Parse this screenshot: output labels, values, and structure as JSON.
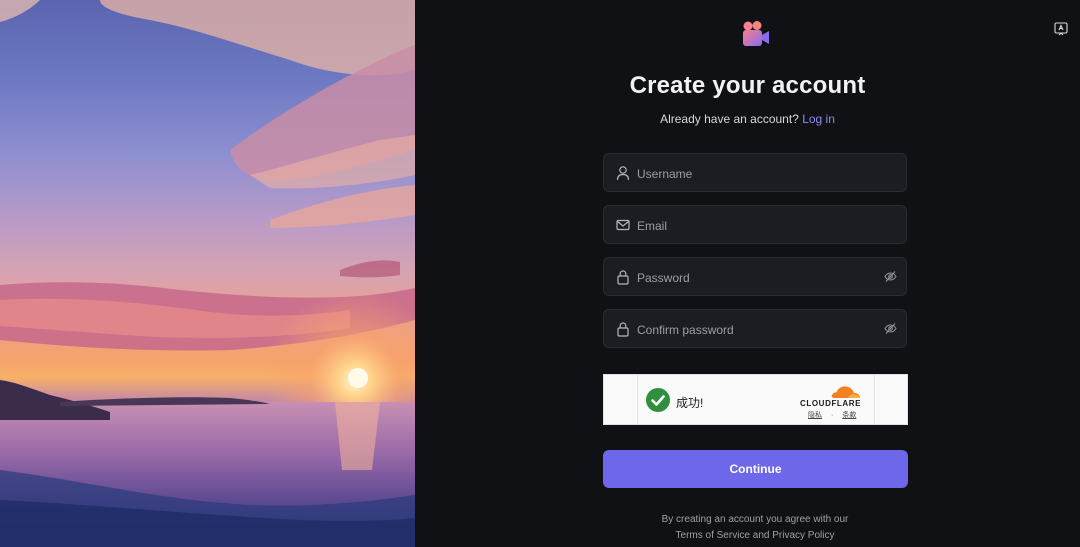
{
  "header": {
    "title": "Create your account",
    "login_prompt": "Already have an account?",
    "login_link": "Log in"
  },
  "form": {
    "username": {
      "placeholder": "Username",
      "icon": "user-icon"
    },
    "email": {
      "placeholder": "Email",
      "icon": "mail-icon"
    },
    "password": {
      "placeholder": "Password",
      "icon": "lock-icon",
      "toggle_icon": "eye-off-icon"
    },
    "confirm_password": {
      "placeholder": "Confirm password",
      "icon": "lock-icon",
      "toggle_icon": "eye-off-icon"
    },
    "submit_label": "Continue"
  },
  "captcha": {
    "status": "成功!",
    "brand": "CLOUDFLARE",
    "privacy": "隐私",
    "separator": "·",
    "terms": "条款"
  },
  "footer": {
    "line1": "By creating an account you agree with our",
    "line2": "Terms of Service and Privacy Policy"
  },
  "colors": {
    "accent": "#6e67ea",
    "link": "#8a8cf5",
    "panel_bg": "#101114",
    "field_bg": "#1c1d22",
    "success": "#2f8f3e",
    "cloudflare_orange": "#f38020"
  }
}
